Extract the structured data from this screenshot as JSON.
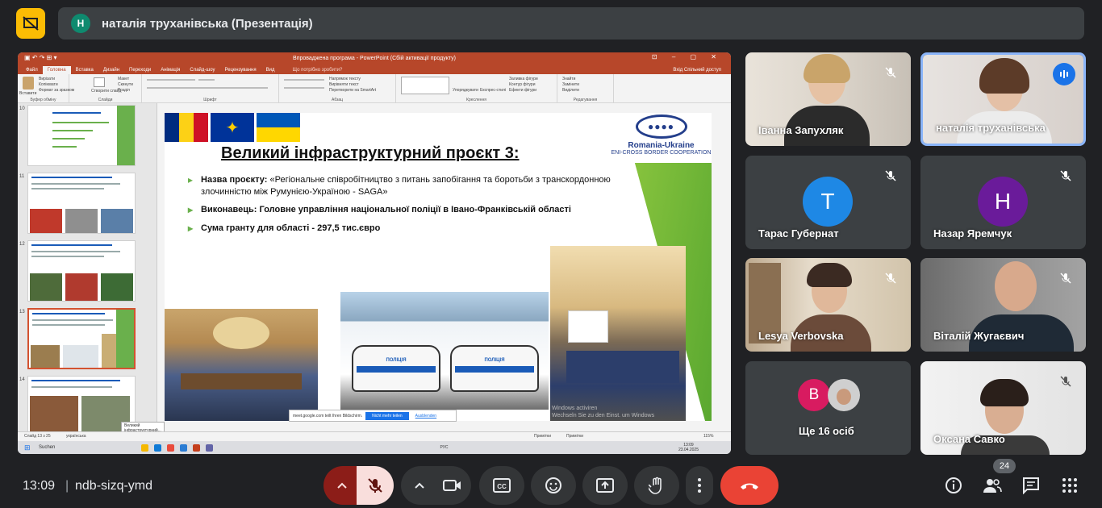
{
  "header": {
    "presenter_avatar": "Н",
    "presenter_label": "наталія труханівська (Презентація)"
  },
  "ppt": {
    "title": "Впроваджена програма - PowerPoint (Сбій активації продукту)",
    "menu": [
      "Файл",
      "Головна",
      "Вставка",
      "Дизайн",
      "Переходи",
      "Анімація",
      "Слайд-шоу",
      "Рецензування",
      "Вид"
    ],
    "search_hint": "Що потрібно зробити?",
    "right_menu": "Вхід   Спільний доступ",
    "ribbon_groups": [
      "Буфер обміну",
      "Слайди",
      "Шрифт",
      "Абзац",
      "Креслення",
      "Редагування"
    ],
    "ribbon_items": [
      "Вставити",
      "Вирізати",
      "Копіювати",
      "Формат за зразком",
      "Створити слайд",
      "Макет",
      "Скинути",
      "Розділ",
      "Напрямок тексту",
      "Вирівняти текст",
      "Перетворити на SmartArt",
      "Упорядкувати",
      "Експрес-стилі",
      "Заливка фігури",
      "Контур фігури",
      "Ефекти фігури",
      "Знайти",
      "Замінити",
      "Виділити"
    ],
    "thumb_numbers": [
      "10",
      "11",
      "12",
      "13",
      "14"
    ],
    "tooltip": "Великий інфраструктурний...",
    "status_left": "Слайд 13 з 25",
    "status_lang": "українська",
    "status_notes": "Примітки",
    "status_comments": "Примітки",
    "status_zoom": "115%",
    "taskbar_search": "Suchen",
    "taskbar_lang": "РУС",
    "taskbar_time": "13:09",
    "taskbar_date": "23.04.2025",
    "notice_text": "meet.google.com teilt Ihren Bildschirm.",
    "notice_button": "Nicht mehr teilen",
    "notice_link": "Ausblenden",
    "watermark_l1": "Windows activiren",
    "watermark_l2": "Wechseln Sie zu den Einst. um Windows"
  },
  "slide": {
    "title": "Великий інфраструктурний проєкт 3:",
    "logo_line1": "Romania-Ukraine",
    "logo_line2": "ENI-CROSS BORDER COOPERATION",
    "b1_label": "Назва проєкту:",
    "b1_text": " «Регіональне співробітництво з питань запобігання та боротьби  з транскордонною злочинністю між Румунією-Україною - SAGA»",
    "b2_text": "Виконавець: Головне управління національної поліції в Івано-Франківській області",
    "b3_text": "Сума гранту для області - 297,5 тис.євро",
    "car_text": "ПОЛІЦІЯ"
  },
  "participants": [
    {
      "name": "Іванна Запухляк",
      "muted": true
    },
    {
      "name": "наталія труханівська",
      "muted": false,
      "speaking": true
    },
    {
      "name": "Тарас Губернат",
      "initial": "Т",
      "color": "#1e88e5",
      "muted": true
    },
    {
      "name": "Назар Яремчук",
      "initial": "Н",
      "color": "#6a1b9a",
      "muted": true
    },
    {
      "name": "Lesya Verbovska",
      "muted": true
    },
    {
      "name": "Віталій Жугаєвич",
      "muted": true
    },
    {
      "name": "Ще 16 осіб",
      "initial": "В",
      "color": "#d81b60"
    },
    {
      "name": "Оксана Савко",
      "muted": true
    }
  ],
  "footer": {
    "time": "13:09",
    "meeting_code": "ndb-sizq-ymd",
    "people_count": "24"
  },
  "colors": {
    "accent": "#8ab4f8",
    "end_call": "#ea4335",
    "present": "#fbbc04"
  }
}
